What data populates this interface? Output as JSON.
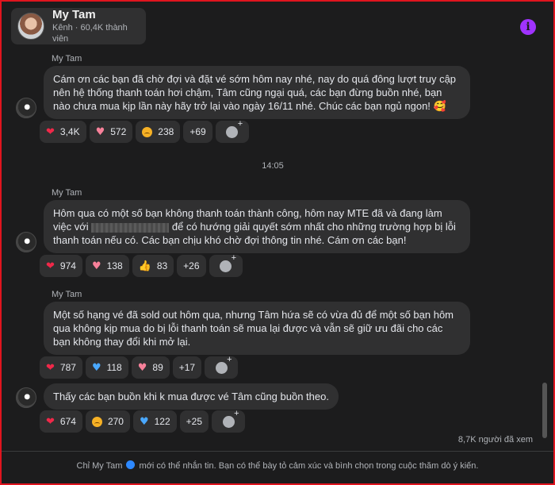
{
  "header": {
    "name": "My Tam",
    "subtitle": "Kênh · 60,4K thành viên"
  },
  "info_icon": "i",
  "messages": [
    {
      "sender": "My Tam",
      "text": "Cám ơn các bạn đã chờ đợi và đặt vé sớm hôm nay nhé, nay do quá đông lượt truy cập nên hệ thống thanh toán hơi chậm, Tâm cũng ngại quá, các bạn đừng buồn nhé, bạn nào chưa mua kịp lần này hãy trở lại vào ngày 16/11 nhé. Chúc các bạn ngủ ngon! 🥰",
      "reactions": [
        {
          "icon": "heart-red",
          "count": "3,4K"
        },
        {
          "icon": "heart-pink",
          "count": "572"
        },
        {
          "icon": "sad-face",
          "count": "238"
        },
        {
          "icon": "more",
          "count": "+69"
        }
      ]
    },
    {
      "sender": "My Tam",
      "text_before": "Hôm qua có một số bạn không thanh toán thành công, hôm nay MTE đã và đang làm việc với",
      "text_after": "để có hướng giải quyết sớm nhất cho những trường hợp bị lỗi thanh toán nếu có. Các bạn chịu khó chờ đợi thông tin nhé. Cám ơn các bạn!",
      "reactions": [
        {
          "icon": "heart-red",
          "count": "974"
        },
        {
          "icon": "heart-pink",
          "count": "138"
        },
        {
          "icon": "thumbs-up",
          "count": "83"
        },
        {
          "icon": "more",
          "count": "+26"
        }
      ]
    },
    {
      "sender": "My Tam",
      "text": "Một số hạng vé đã sold out hôm qua, nhưng Tâm hứa sẽ có vừa đủ để một số bạn hôm qua không kịp mua do bị lỗi thanh toán sẽ mua lại được và vẫn sẽ giữ ưu đãi cho các bạn không thay đổi khi mở lại.",
      "reactions": [
        {
          "icon": "heart-red",
          "count": "787"
        },
        {
          "icon": "heart-blue",
          "count": "118"
        },
        {
          "icon": "heart-pink",
          "count": "89"
        },
        {
          "icon": "more",
          "count": "+17"
        }
      ]
    },
    {
      "text": "Thấy các bạn buồn khi k mua được vé Tâm cũng buồn theo.",
      "reactions": [
        {
          "icon": "heart-red",
          "count": "674"
        },
        {
          "icon": "sad-face",
          "count": "270"
        },
        {
          "icon": "heart-blue",
          "count": "122"
        },
        {
          "icon": "more",
          "count": "+25"
        }
      ]
    }
  ],
  "timestamp": "14:05",
  "seen": "8,7K người đã xem",
  "footer": {
    "before": "Chỉ My Tam",
    "after": "mới có thể nhắn tin. Bạn có thể bày tỏ cảm xúc và bình chọn trong cuộc thăm dò ý kiến."
  }
}
